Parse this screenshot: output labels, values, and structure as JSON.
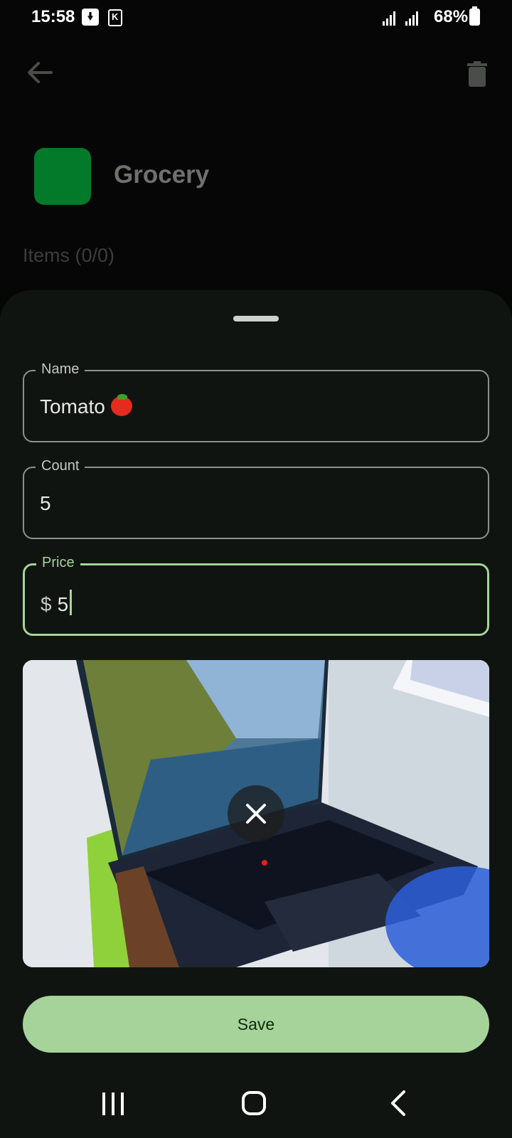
{
  "status_bar": {
    "time": "15:58",
    "battery": "68%"
  },
  "header": {
    "list_name": "Grocery",
    "items_label": "Items (0/0)",
    "list_color": "#027a2a"
  },
  "form": {
    "name": {
      "label": "Name",
      "value": "Tomato"
    },
    "count": {
      "label": "Count",
      "value": "5"
    },
    "price": {
      "label": "Price",
      "prefix": "$",
      "value": "5"
    }
  },
  "save_label": "Save",
  "colors": {
    "accent": "#a6d39a",
    "sheet": "#101411",
    "background": "#050605"
  },
  "icons": [
    "back-arrow-icon",
    "trash-icon",
    "close-icon",
    "recents-icon",
    "home-icon",
    "back-nav-icon"
  ]
}
